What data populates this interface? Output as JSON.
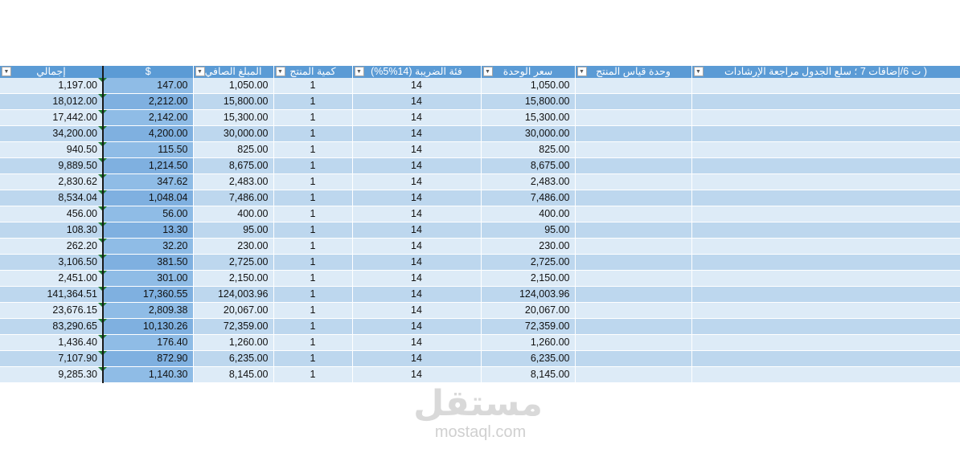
{
  "headers": [
    {
      "label": "إجمالي",
      "filter": true
    },
    {
      "label": "$",
      "filter": false
    },
    {
      "label": "المبلغ الصافي",
      "filter": true
    },
    {
      "label": "كمية المنتج",
      "filter": true
    },
    {
      "label": "فئة الضريبة (14%5%)",
      "filter": true
    },
    {
      "label": "سعر الوحدة",
      "filter": true
    },
    {
      "label": "وحدة قياس المنتج",
      "filter": true
    },
    {
      "label": "ت 6/إضافات 7 ؛ سلع الجدول مراجعة الإرشادات )",
      "filter": true
    }
  ],
  "rows": [
    [
      "1,197.00",
      "147.00",
      "1,050.00",
      "1",
      "14",
      "1,050.00"
    ],
    [
      "18,012.00",
      "2,212.00",
      "15,800.00",
      "1",
      "14",
      "15,800.00"
    ],
    [
      "17,442.00",
      "2,142.00",
      "15,300.00",
      "1",
      "14",
      "15,300.00"
    ],
    [
      "34,200.00",
      "4,200.00",
      "30,000.00",
      "1",
      "14",
      "30,000.00"
    ],
    [
      "940.50",
      "115.50",
      "825.00",
      "1",
      "14",
      "825.00"
    ],
    [
      "9,889.50",
      "1,214.50",
      "8,675.00",
      "1",
      "14",
      "8,675.00"
    ],
    [
      "2,830.62",
      "347.62",
      "2,483.00",
      "1",
      "14",
      "2,483.00"
    ],
    [
      "8,534.04",
      "1,048.04",
      "7,486.00",
      "1",
      "14",
      "7,486.00"
    ],
    [
      "456.00",
      "56.00",
      "400.00",
      "1",
      "14",
      "400.00"
    ],
    [
      "108.30",
      "13.30",
      "95.00",
      "1",
      "14",
      "95.00"
    ],
    [
      "262.20",
      "32.20",
      "230.00",
      "1",
      "14",
      "230.00"
    ],
    [
      "3,106.50",
      "381.50",
      "2,725.00",
      "1",
      "14",
      "2,725.00"
    ],
    [
      "2,451.00",
      "301.00",
      "2,150.00",
      "1",
      "14",
      "2,150.00"
    ],
    [
      "141,364.51",
      "17,360.55",
      "124,003.96",
      "1",
      "14",
      "124,003.96"
    ],
    [
      "23,676.15",
      "2,809.38",
      "20,067.00",
      "1",
      "14",
      "20,067.00"
    ],
    [
      "83,290.65",
      "10,130.26",
      "72,359.00",
      "1",
      "14",
      "72,359.00"
    ],
    [
      "1,436.40",
      "176.40",
      "1,260.00",
      "1",
      "14",
      "1,260.00"
    ],
    [
      "7,107.90",
      "872.90",
      "6,235.00",
      "1",
      "14",
      "6,235.00"
    ],
    [
      "9,285.30",
      "1,140.30",
      "8,145.00",
      "1",
      "14",
      "8,145.00"
    ]
  ],
  "watermark": {
    "arabic": "مستقل",
    "latin": "mostaql.com"
  },
  "colors": {
    "header": "#5b9bd5",
    "row_light": "#ddebf7",
    "row_dark": "#bdd7ee",
    "selected_column": "#8fbce6",
    "error_flag": "#1e7b34"
  }
}
